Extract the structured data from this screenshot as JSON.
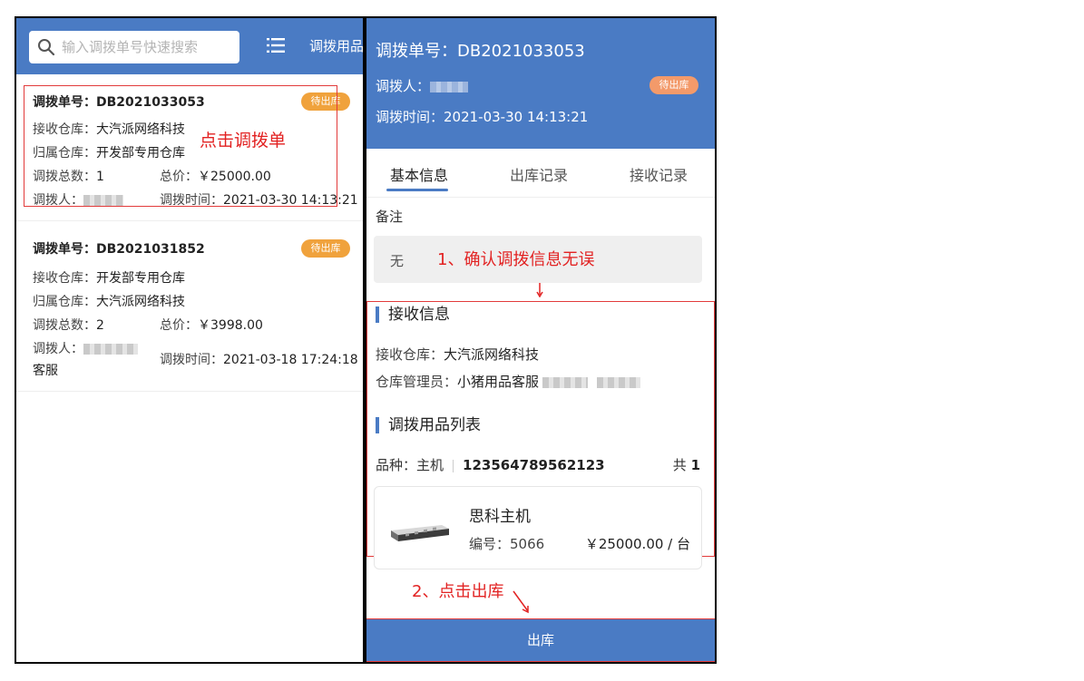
{
  "left": {
    "search": {
      "placeholder": "输入调拨单号快速搜索"
    },
    "header_link": "调拨用品",
    "orders": [
      {
        "order_label": "调拨单号：",
        "order_no": "DB2021033053",
        "status": "待出库",
        "receive_label": "接收仓库：",
        "receive_value": "大汽派网络科技",
        "belong_label": "归属仓库：",
        "belong_value": "开发部专用仓库",
        "count_label": "调拨总数：",
        "count_value": "1",
        "price_label": "总价：",
        "price_value": "￥25000.00",
        "person_label": "调拨人：",
        "person_extra": "",
        "time_label": "调拨时间：",
        "time_value": "2021-03-30 14:13:21"
      },
      {
        "order_label": "调拨单号：",
        "order_no": "DB2021031852",
        "status": "待出库",
        "receive_label": "接收仓库：",
        "receive_value": "开发部专用仓库",
        "belong_label": "归属仓库：",
        "belong_value": "大汽派网络科技",
        "count_label": "调拨总数：",
        "count_value": "2",
        "price_label": "总价：",
        "price_value": "￥3998.00",
        "person_label": "调拨人：",
        "person_extra": "客服",
        "time_label": "调拨时间：",
        "time_value": "2021-03-18 17:24:18"
      }
    ]
  },
  "annotations": {
    "click_card": "点击调拨单",
    "confirm_info": "1、确认调拨信息无误",
    "click_outbound": "2、点击出库"
  },
  "detail": {
    "order_no": "调拨单号：DB2021033053",
    "transferrer_label": "调拨人：",
    "status": "待出库",
    "time": "调拨时间：2021-03-30 14:13:21",
    "tabs": [
      "基本信息",
      "出库记录",
      "接收记录"
    ],
    "remarks_label": "备注",
    "remarks_value": "无",
    "receive_section_title": "接收信息",
    "receive_warehouse_label": "接收仓库：",
    "receive_warehouse_value": "大汽派网络科技",
    "manager_label": "仓库管理员：",
    "manager_value": "小猪用品客服",
    "items_section_title": "调拨用品列表",
    "variety_label": "品种：",
    "variety_value": "主机",
    "variety_code": "123564789562123",
    "total_label": "共",
    "total_value": "1",
    "product": {
      "name": "思科主机",
      "number_label": "编号：",
      "number_value": "5066",
      "price": "￥25000.00 / 台"
    },
    "outbound_button": "出库"
  },
  "colors": {
    "header_blue": "#4a7bc4",
    "badge_orange": "#f0a23c",
    "annotation_red": "#e22222"
  },
  "icons": [
    "search-icon",
    "list-icon",
    "arrow-down-icon",
    "arrow-diagonal-icon"
  ]
}
